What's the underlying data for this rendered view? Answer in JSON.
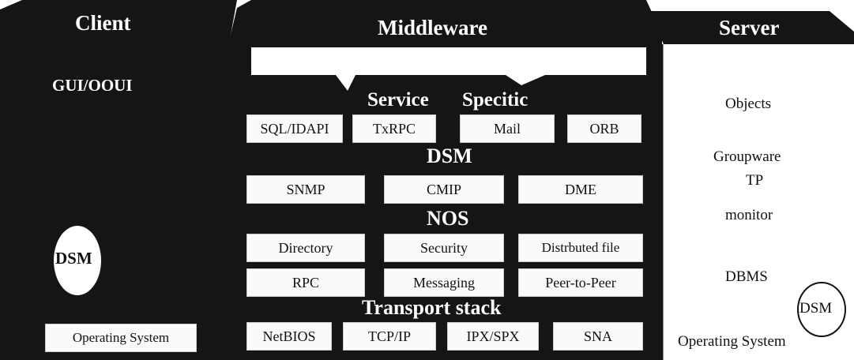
{
  "headers": {
    "client": "Client",
    "middleware": "Middleware",
    "server": "Server"
  },
  "client": {
    "gui": "GUI/OOUI",
    "dsm": "DSM",
    "os": "Operating System"
  },
  "middleware": {
    "service_specific": {
      "label_left": "Service",
      "label_right": "Specitic",
      "items": [
        "SQL/IDAPI",
        "TxRPC",
        "Mail",
        "ORB"
      ]
    },
    "dsm": {
      "label": "DSM",
      "items": [
        "SNMP",
        "CMIP",
        "DME"
      ]
    },
    "nos": {
      "label": "NOS",
      "row1": [
        "Directory",
        "Security",
        "Distrbuted file"
      ],
      "row2": [
        "RPC",
        "Messaging",
        "Peer-to-Peer"
      ]
    },
    "transport": {
      "label": "Transport stack",
      "items": [
        "NetBIOS",
        "TCP/IP",
        "IPX/SPX",
        "SNA"
      ]
    }
  },
  "server": {
    "objects": "Objects",
    "groupware": "Groupware",
    "tp": "TP",
    "monitor": "monitor",
    "dbms": "DBMS",
    "dsm": "DSM",
    "os": "Operating System"
  },
  "colors": {
    "panel": "#151515",
    "box": "#fafafa",
    "server_bg": "#ffffff"
  }
}
